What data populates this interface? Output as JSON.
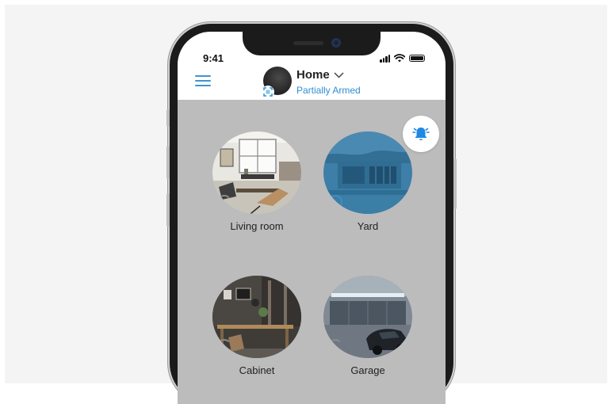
{
  "status_bar": {
    "time": "9:41"
  },
  "header": {
    "hub_name": "Home",
    "hub_status": "Partially Armed"
  },
  "icons": {
    "menu": "hamburger-menu-icon",
    "hub_dropdown": "chevron-down-icon",
    "hub_mode": "partial-arm-icon",
    "alarm": "alarm-bell-icon",
    "room_state": "arm-state-ring-icon"
  },
  "colors": {
    "accent_blue": "#2e8fd3",
    "screen_dimmed": "#bcbcbc",
    "alarm_icon": "#1e88e5"
  },
  "rooms": [
    {
      "name": "Living room",
      "armed": false
    },
    {
      "name": "Yard",
      "armed": true
    },
    {
      "name": "Cabinet",
      "armed": false
    },
    {
      "name": "Garage",
      "armed": false
    }
  ]
}
